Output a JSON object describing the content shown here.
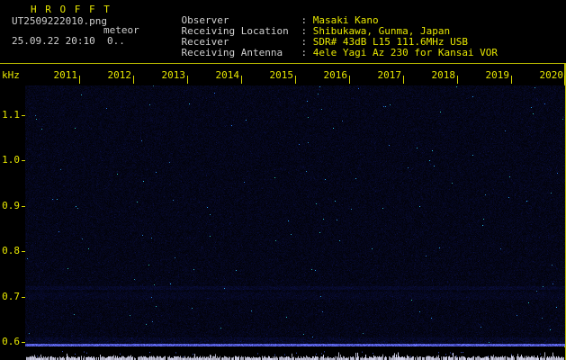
{
  "app": {
    "title_display": "H R O F F T"
  },
  "header": {
    "filename": "UT2509222010.png",
    "mode": "meteor",
    "datetime": "25.09.22 20:10  0..",
    "info": [
      {
        "label": "Observer",
        "sep": ": ",
        "value": "Masaki Kano"
      },
      {
        "label": "Receiving Location",
        "sep": ": ",
        "value": "Shibukawa, Gunma, Japan"
      },
      {
        "label": "Receiver",
        "sep": ": ",
        "value": "SDR# 43dB L15 111.6MHz USB"
      },
      {
        "label": "Receiving Antenna",
        "sep": ": ",
        "value": "4ele Yagi Az 230 for Kansai VOR"
      }
    ]
  },
  "axes": {
    "y_unit": "kHz",
    "time_ticks": [
      "2011",
      "2012",
      "2013",
      "2014",
      "2015",
      "2016",
      "2017",
      "2018",
      "2019",
      "2020"
    ],
    "freq_ticks": [
      "1.1",
      "1.0",
      "0.9",
      "0.8",
      "0.7",
      "0.6"
    ]
  },
  "chart_data": {
    "type": "heatmap",
    "title": "",
    "x_tick_labels": [
      "2011",
      "2012",
      "2013",
      "2014",
      "2015",
      "2016",
      "2017",
      "2018",
      "2019",
      "2020"
    ],
    "x_start_hhmm": "2010",
    "x_minutes_per_tick": 1,
    "ylabel": "kHz",
    "y_tick_labels": [
      "1.1",
      "1.0",
      "0.9",
      "0.8",
      "0.7",
      "0.6"
    ],
    "ylim_khz": [
      0.59,
      1.16
    ],
    "legend": "none",
    "grid": false,
    "features": [
      {
        "kind": "noise-floor",
        "description": "uniform dark blue background noise across all times and frequencies"
      },
      {
        "kind": "carrier-band",
        "frequency_khz": 0.72,
        "description": "faint continuous horizontal band across full width"
      },
      {
        "kind": "baseline-line",
        "frequency_khz": 0.59,
        "description": "bright continuous pale-blue line along bottom edge of spectrogram"
      },
      {
        "kind": "signal-level-trace",
        "description": "flat white noise trace in bottom strip, no meteor echo spikes"
      }
    ]
  },
  "colors": {
    "background": "#000000",
    "axis_yellow": "#e6e600",
    "label_gray": "#cfcfcf",
    "spectrogram_base": "#000018",
    "carrier_line": "#8890d8",
    "signal_trace": "#d8d8e8"
  }
}
